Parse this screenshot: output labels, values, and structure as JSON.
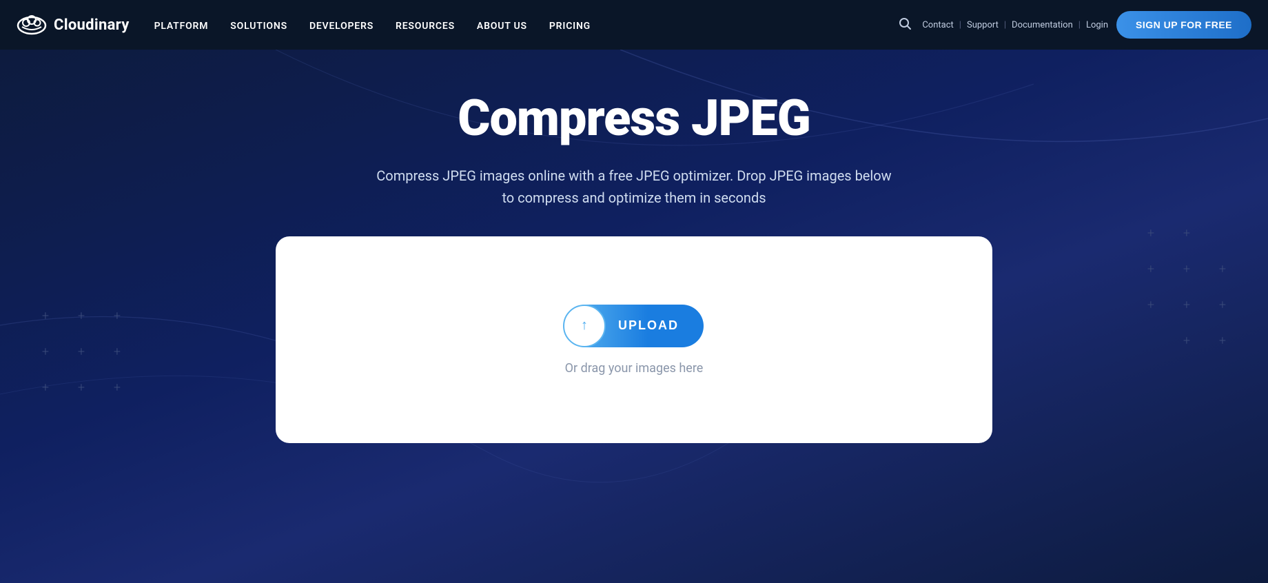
{
  "navbar": {
    "logo_text": "Cloudinary",
    "nav_links": [
      {
        "id": "platform",
        "label": "PLATFORM"
      },
      {
        "id": "solutions",
        "label": "SOLUTIONS"
      },
      {
        "id": "developers",
        "label": "DEVELOPERS"
      },
      {
        "id": "resources",
        "label": "RESOURCES"
      },
      {
        "id": "about",
        "label": "ABOUT US"
      },
      {
        "id": "pricing",
        "label": "PRICING"
      }
    ],
    "utility_links": [
      {
        "id": "contact",
        "label": "Contact"
      },
      {
        "id": "support",
        "label": "Support"
      },
      {
        "id": "documentation",
        "label": "Documentation"
      },
      {
        "id": "login",
        "label": "Login"
      }
    ],
    "signup_label": "SIGN UP FOR FREE"
  },
  "hero": {
    "title": "Compress JPEG",
    "subtitle": "Compress JPEG images online with a free JPEG optimizer. Drop JPEG images below to compress and optimize them in seconds"
  },
  "upload_card": {
    "button_label": "UPLOAD",
    "drag_text": "Or drag your images here"
  },
  "decorations": {
    "plus_symbol": "+"
  }
}
